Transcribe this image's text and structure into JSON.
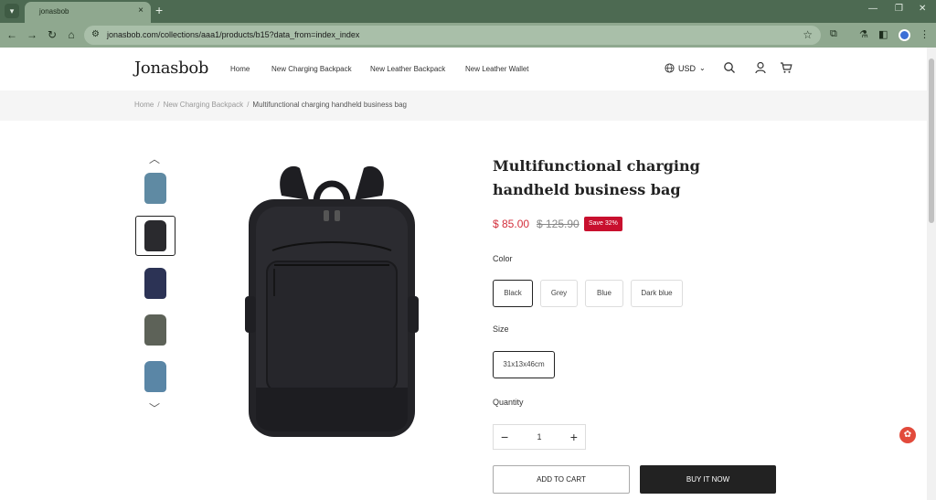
{
  "browser": {
    "tab_title": "jonasbob",
    "tab_menu_icon": "chevron-down-icon",
    "close_icon": "×",
    "new_tab_icon": "+",
    "url": "jonasbob.com/collections/aaa1/products/b15?data_from=index_index"
  },
  "header": {
    "logo": "Jonasbob",
    "nav": [
      "Home",
      "New Charging Backpack",
      "New Leather Backpack",
      "New Leather Wallet"
    ],
    "currency": "USD"
  },
  "breadcrumb": {
    "items": [
      "Home",
      "New Charging Backpack"
    ],
    "separator": "/",
    "current": "Multifunctional charging handheld business bag"
  },
  "gallery": {
    "thumbnail_colors": [
      "#5f8aa3",
      "#2a2a2e",
      "#2c3355",
      "#5d6258",
      "#5a86a6"
    ],
    "active_index": 1,
    "up_arrow": "︿",
    "down_arrow": "﹀"
  },
  "product": {
    "title": "Multifunctional charging handheld business bag",
    "price": "$ 85.00",
    "compare_price": "$ 125.90",
    "save_badge": "Save 32%",
    "color_label": "Color",
    "colors": [
      "Black",
      "Grey",
      "Blue",
      "Dark blue"
    ],
    "selected_color": "Black",
    "size_label": "Size",
    "sizes": [
      "31x13x46cm"
    ],
    "quantity_label": "Quantity",
    "quantity": "1",
    "minus": "−",
    "plus": "+",
    "add_to_cart": "ADD TO CART",
    "buy_now": "BUY IT NOW"
  },
  "colors": {
    "accent": "#d32f3c",
    "badge": "#c8102e",
    "buy_button": "#222222",
    "chrome": "#8fa88f"
  }
}
